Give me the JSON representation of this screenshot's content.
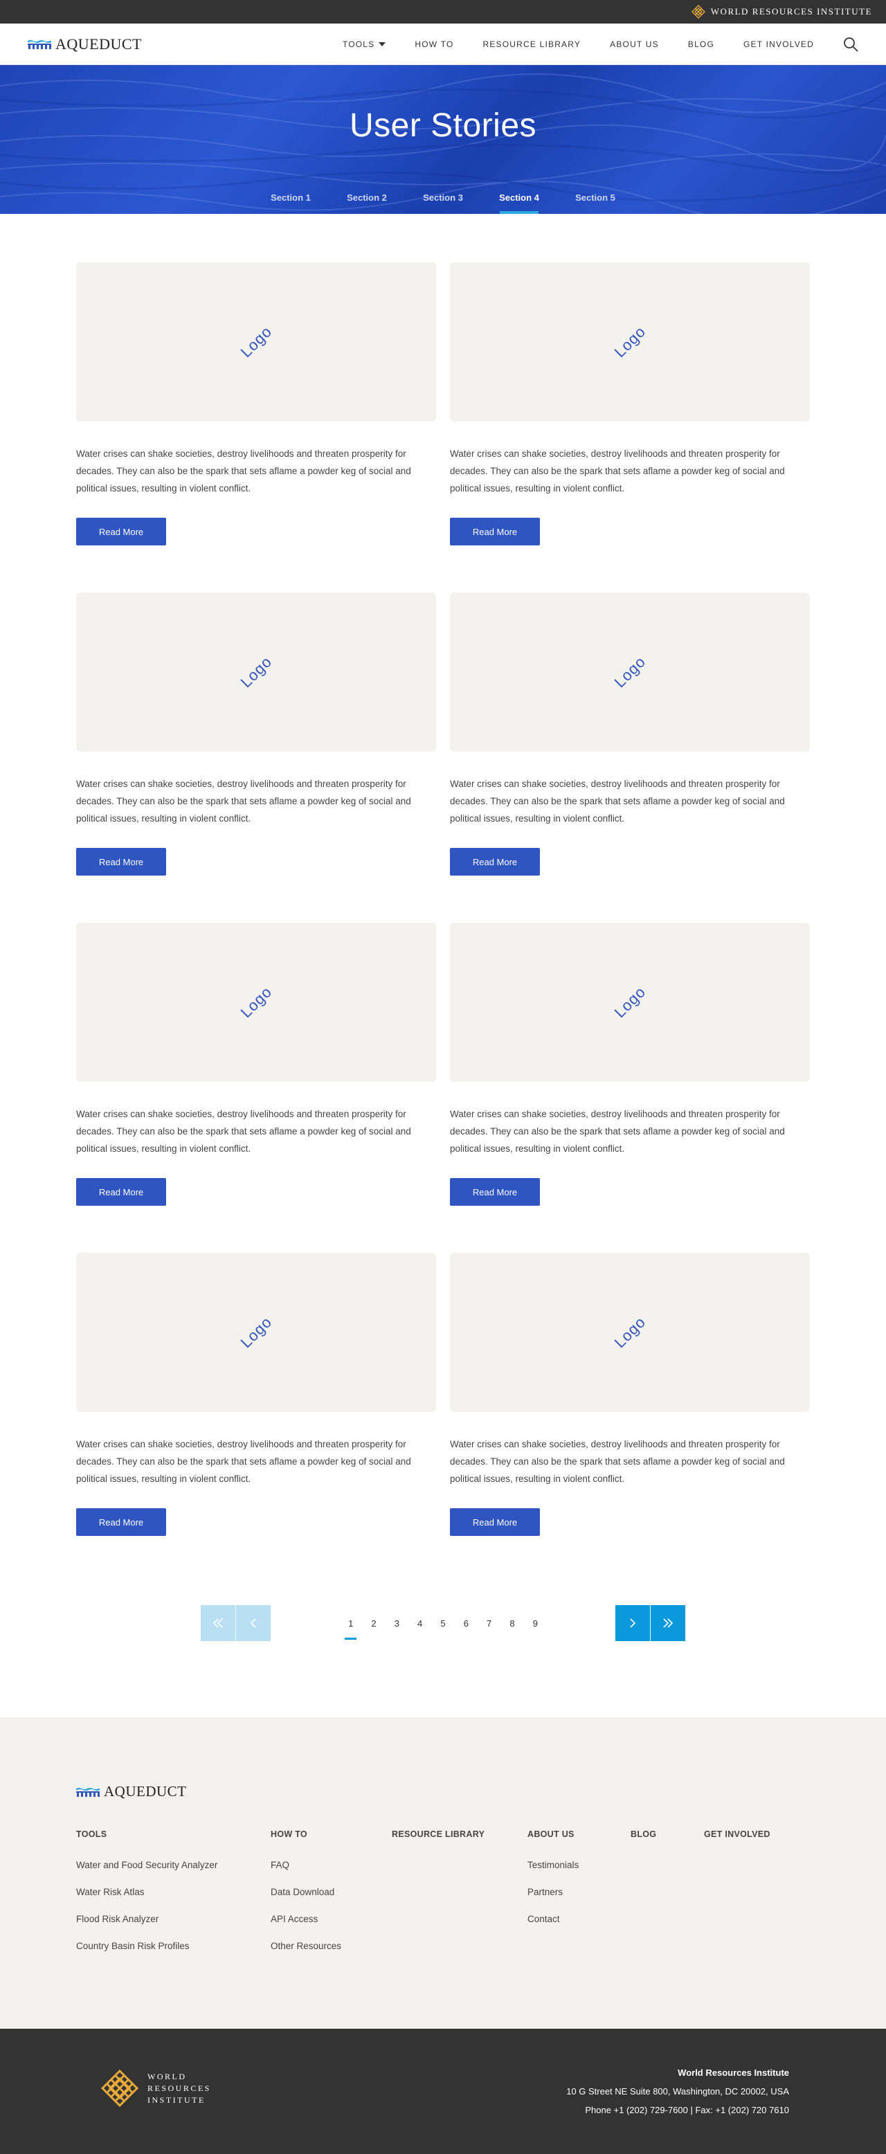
{
  "topbar": {
    "org_label": "WORLD RESOURCES INSTITUTE"
  },
  "header": {
    "brand": "AQUEDUCT",
    "nav": [
      {
        "label": "TOOLS",
        "has_dropdown": true
      },
      {
        "label": "HOW TO"
      },
      {
        "label": "RESOURCE LIBRARY"
      },
      {
        "label": "ABOUT US"
      },
      {
        "label": "BLOG"
      },
      {
        "label": "GET INVOLVED"
      }
    ],
    "search_icon": "search-icon"
  },
  "hero": {
    "title": "User Stories",
    "tabs": [
      "Section 1",
      "Section 2",
      "Section 3",
      "Section 4",
      "Section 5"
    ],
    "active_tab": "Section 4"
  },
  "stories": [
    {
      "logo": "Logo",
      "text": "Water crises can shake societies, destroy livelihoods and threaten prosperity for decades. They can also be the spark that sets aflame a powder keg of social and political issues, resulting in violent conflict.",
      "button": "Read More"
    },
    {
      "logo": "Logo",
      "text": "Water crises can shake societies, destroy livelihoods and threaten prosperity for decades. They can also be the spark that sets aflame a powder keg of social and political issues, resulting in violent conflict.",
      "button": "Read More"
    },
    {
      "logo": "Logo",
      "text": "Water crises can shake societies, destroy livelihoods and threaten prosperity for decades. They can also be the spark that sets aflame a powder keg of social and political issues, resulting in violent conflict.",
      "button": "Read More"
    },
    {
      "logo": "Logo",
      "text": "Water crises can shake societies, destroy livelihoods and threaten prosperity for decades. They can also be the spark that sets aflame a powder keg of social and political issues, resulting in violent conflict.",
      "button": "Read More"
    },
    {
      "logo": "Logo",
      "text": "Water crises can shake societies, destroy livelihoods and threaten prosperity for decades. They can also be the spark that sets aflame a powder keg of social and political issues, resulting in violent conflict.",
      "button": "Read More"
    },
    {
      "logo": "Logo",
      "text": "Water crises can shake societies, destroy livelihoods and threaten prosperity for decades. They can also be the spark that sets aflame a powder keg of social and political issues, resulting in violent conflict.",
      "button": "Read More"
    },
    {
      "logo": "Logo",
      "text": "Water crises can shake societies, destroy livelihoods and threaten prosperity for decades. They can also be the spark that sets aflame a powder keg of social and political issues, resulting in violent conflict.",
      "button": "Read More"
    },
    {
      "logo": "Logo",
      "text": "Water crises can shake societies, destroy livelihoods and threaten prosperity for decades. They can also be the spark that sets aflame a powder keg of social and political issues, resulting in violent conflict.",
      "button": "Read More"
    }
  ],
  "pagination": {
    "pages": [
      "1",
      "2",
      "3",
      "4",
      "5",
      "6",
      "7",
      "8",
      "9"
    ],
    "current": "1"
  },
  "footer": {
    "brand": "AQUEDUCT",
    "columns": [
      {
        "title": "TOOLS",
        "links": [
          "Water and Food Security Analyzer",
          "Water Risk Atlas",
          "Flood Risk Analyzer",
          "Country Basin Risk Profiles"
        ]
      },
      {
        "title": "HOW TO",
        "links": [
          "FAQ",
          "Data Download",
          "API Access",
          "Other Resources"
        ]
      },
      {
        "title": "RESOURCE LIBRARY",
        "links": []
      },
      {
        "title": "ABOUT US",
        "links": [
          "Testimonials",
          "Partners",
          "Contact"
        ]
      },
      {
        "title": "BLOG",
        "links": []
      },
      {
        "title": "GET INVOLVED",
        "links": []
      }
    ],
    "wri": {
      "name_lines": [
        "WORLD",
        "RESOURCES",
        "INSTITUTE"
      ],
      "org": "World Resources Institute",
      "address": "10 G Street NE Suite 800, Washington, DC 20002, USA",
      "phone": "Phone +1 (202) 729-7600 | Fax: +1 (202) 720 7610"
    }
  },
  "colors": {
    "accent_blue": "#2f55c0",
    "pagination_blue": "#0a9adb",
    "topbar_dark": "#333333",
    "footer_light": "#f4f2ef",
    "wri_gold": "#e8a93a"
  }
}
